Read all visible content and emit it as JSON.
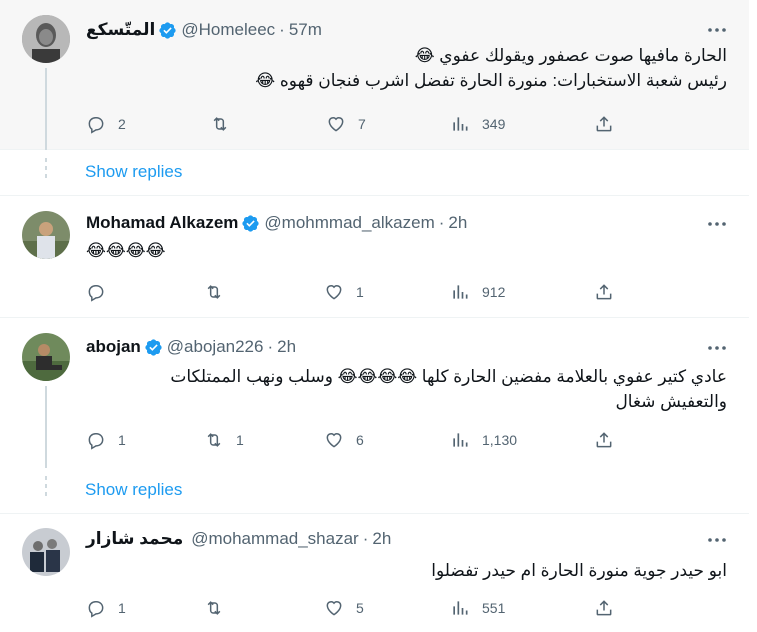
{
  "colors": {
    "accent": "#1d9bf0",
    "muted": "#536471",
    "text": "#0f1419",
    "verified": "#1d9bf0"
  },
  "tweets": [
    {
      "name": "المتّسكع",
      "verified": true,
      "handle": "@Homeleec",
      "time": "57m",
      "lines": [
        "الحارة مافيها صوت عصفور ويقولك عفوي 😂",
        "رئيس شعبة الاستخبارات: منورة الحارة تفضل اشرب فنجان قهوه 😂"
      ],
      "replies": "2",
      "retweets": "",
      "likes": "7",
      "views": "349",
      "avatar_icon": "profile-photo-man-beard"
    },
    {
      "name": "Mohamad Alkazem",
      "verified": true,
      "handle": "@mohmmad_alkazem",
      "time": "2h",
      "lines": [
        "😂😂😂😂"
      ],
      "replies": "",
      "retweets": "",
      "likes": "1",
      "views": "912",
      "avatar_icon": "profile-photo-man-outdoors"
    },
    {
      "name": "abojan",
      "verified": true,
      "handle": "@abojan226",
      "time": "2h",
      "lines": [
        "عادي كتير عفوي  بالعلامة مفضين الحارة كلها 😂😂😂😂 وسلب ونهب الممتلكات",
        "والتعفيش شغال"
      ],
      "replies": "1",
      "retweets": "1",
      "likes": "6",
      "views": "1,130",
      "avatar_icon": "profile-photo-man-sitting"
    },
    {
      "name": "محمد شازار",
      "verified": false,
      "handle": "@mohammad_shazar",
      "time": "2h",
      "lines": [
        "ابو حيدر جوية منورة الحارة ام حيدر  تفضلوا"
      ],
      "replies": "1",
      "retweets": "",
      "likes": "5",
      "views": "551",
      "avatar_icon": "profile-photo-group"
    }
  ],
  "show_replies_label": "Show replies",
  "separator": "·"
}
